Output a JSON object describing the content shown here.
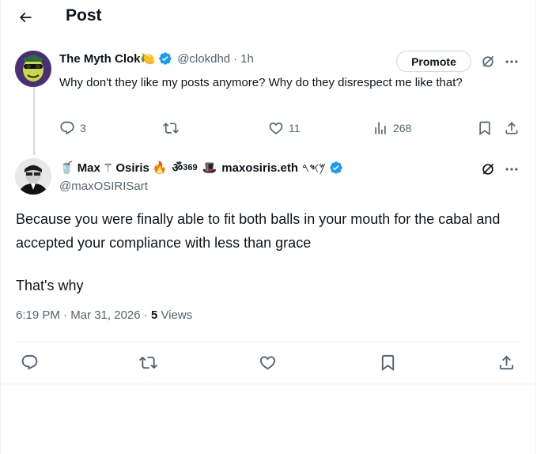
{
  "header": {
    "title": "Post"
  },
  "reply_parent": {
    "name": "The Myth Clok",
    "name_emoji": "🍋",
    "handle": "@clokdhd",
    "separator": "·",
    "time": "1h",
    "promote_label": "Promote",
    "text": "Why don't they like my posts anymore? Why do they disrespect me like that?",
    "stats": {
      "replies": "3",
      "likes": "11",
      "views": "268"
    }
  },
  "main_post": {
    "name_prefix_emoji": "🥤",
    "name": "Max",
    "name_symbol": "⚚",
    "name_rest": "Osiris",
    "name_fire": "🔥",
    "name_om": "ॐ",
    "name_sup": "369",
    "name_hat": "🎩",
    "name_eth": "maxosiris.eth",
    "name_script": "𐤌𐤎𐤓",
    "handle": "@maxOSIRISart",
    "paragraph1": "Because you were finally able to fit both balls in your mouth for the cabal and accepted your compliance with less than grace",
    "paragraph2": "That's why",
    "time": "6:19 PM",
    "separator1": "·",
    "date": "Mar 31, 2026",
    "separator2": "·",
    "views_count": "5",
    "views_label": "Views"
  },
  "colors": {
    "verified": "#1d9bf0",
    "muted": "#536471",
    "text": "#0f1419",
    "border": "#eff3f4"
  }
}
